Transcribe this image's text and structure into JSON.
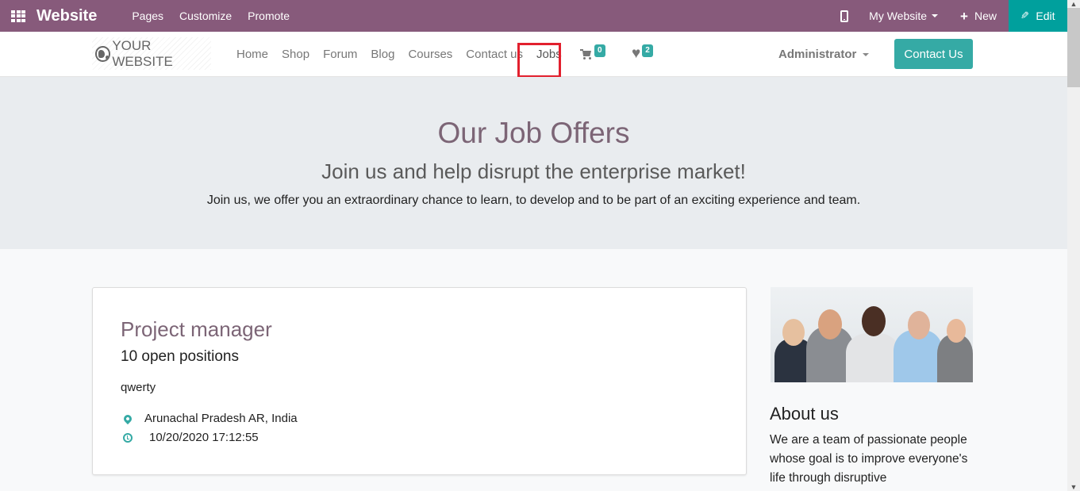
{
  "topbar": {
    "app_title": "Website",
    "menus": [
      "Pages",
      "Customize",
      "Promote"
    ],
    "website_selector": "My Website",
    "new_label": "New",
    "edit_label": "Edit",
    "colors": {
      "bar": "#875a7b",
      "edit": "#00a09d"
    }
  },
  "navbar": {
    "logo_text": "YOUR WEBSITE",
    "links": [
      "Home",
      "Shop",
      "Forum",
      "Blog",
      "Courses",
      "Contact us",
      "Jobs"
    ],
    "active_link": "Jobs",
    "cart_count": "0",
    "wishlist_count": "2",
    "user": "Administrator",
    "contact_button": "Contact Us",
    "accent": "#35aaa5",
    "highlight_box_color": "#e2202e"
  },
  "hero": {
    "title": "Our Job Offers",
    "subtitle": "Join us and help disrupt the enterprise market!",
    "text": "Join us, we offer you an extraordinary chance to learn, to develop and to be part of an exciting experience and team."
  },
  "jobs": [
    {
      "title": "Project manager",
      "open_positions": "10 open positions",
      "description": "qwerty",
      "location": "Arunachal Pradesh AR, India",
      "published": "10/20/2020 17:12:55"
    }
  ],
  "about": {
    "image_alt": "team photo",
    "title": "About us",
    "text": "We are a team of passionate people whose goal is to improve everyone's life through disruptive"
  }
}
